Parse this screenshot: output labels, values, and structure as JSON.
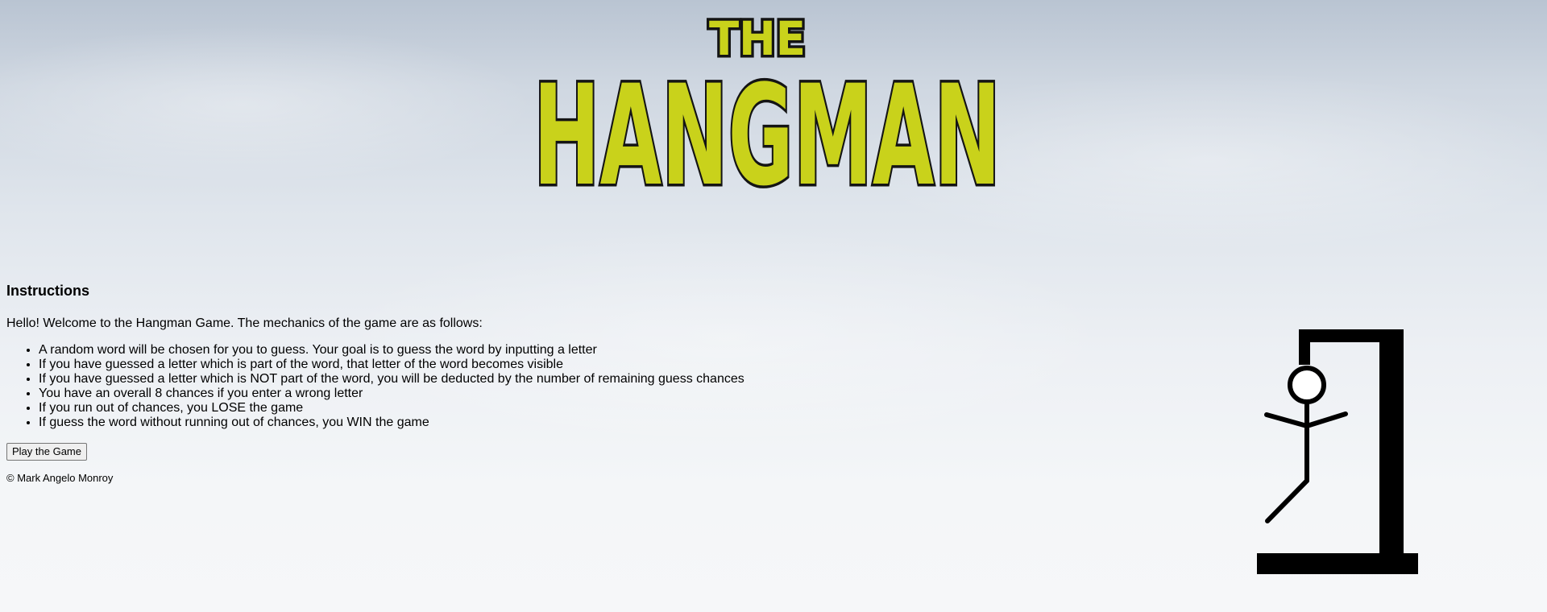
{
  "logo": {
    "line1": "THE",
    "line2": "HANGMAN"
  },
  "instructions": {
    "heading": "Instructions",
    "intro": "Hello! Welcome to the Hangman Game. The mechanics of the game are as follows:",
    "rules": [
      "A random word will be chosen for you to guess. Your goal is to guess the word by inputting a letter",
      "If you have guessed a letter which is part of the word, that letter of the word becomes visible",
      "If you have guessed a letter which is NOT part of the word, you will be deducted by the number of remaining guess chances",
      "You have an overall 8 chances if you enter a wrong letter",
      "If you run out of chances, you LOSE the game",
      "If guess the word without running out of chances, you WIN the game"
    ]
  },
  "actions": {
    "play_label": "Play the Game"
  },
  "footer": {
    "copyright": "© Mark Angelo Monroy"
  },
  "colors": {
    "logo_fill": "#c9d21b",
    "logo_outline": "#141414",
    "gallows": "#000000"
  }
}
